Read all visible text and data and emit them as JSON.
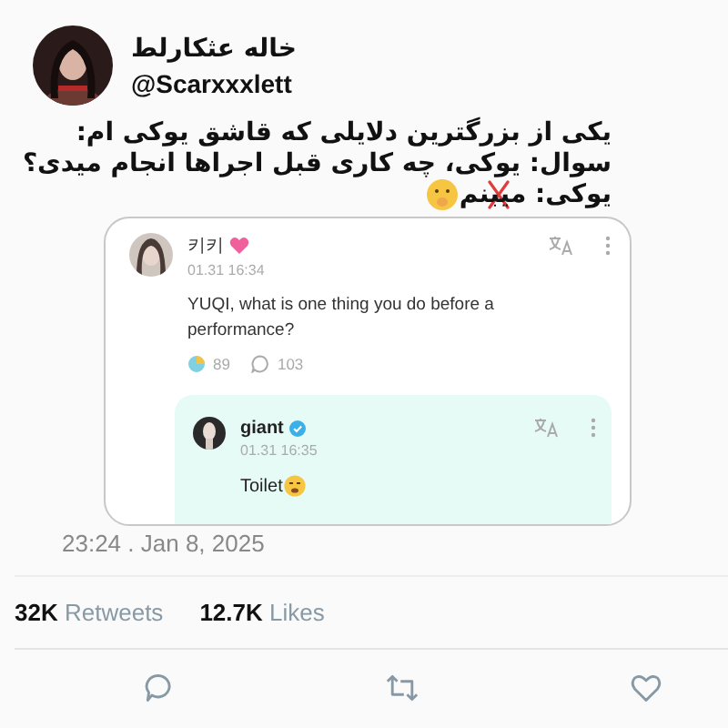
{
  "author": {
    "name": "خاله عثکارلط",
    "handle": "@Scarxxxlett"
  },
  "tweet_lines": [
    {
      "text": "یکی از بزرگترین دلایلی که قاشق یوکی ام:",
      "struck": false
    },
    {
      "text": "سوال: یوکی، چه کاری قبل اجراها انجام میدی؟",
      "struck": false
    },
    {
      "text": "یوکی: میبنم",
      "struck": true
    }
  ],
  "embedded_post": {
    "author": "키키",
    "time": "01.31 16:34",
    "text": "YUQI, what is one thing you do before a performance?",
    "reactions": "89",
    "comments": "103",
    "reply": {
      "author": "giant",
      "verified": true,
      "time": "01.31 16:35",
      "text": "Toilet"
    }
  },
  "timestamp": "23:24 . Jan 8, 2025",
  "stats": [
    {
      "count": "32K",
      "label": "Retweets"
    },
    {
      "count": "12.7K",
      "label": "Likes"
    }
  ],
  "actions": [
    {
      "kind": "reply"
    },
    {
      "kind": "retweet"
    },
    {
      "kind": "like"
    }
  ]
}
